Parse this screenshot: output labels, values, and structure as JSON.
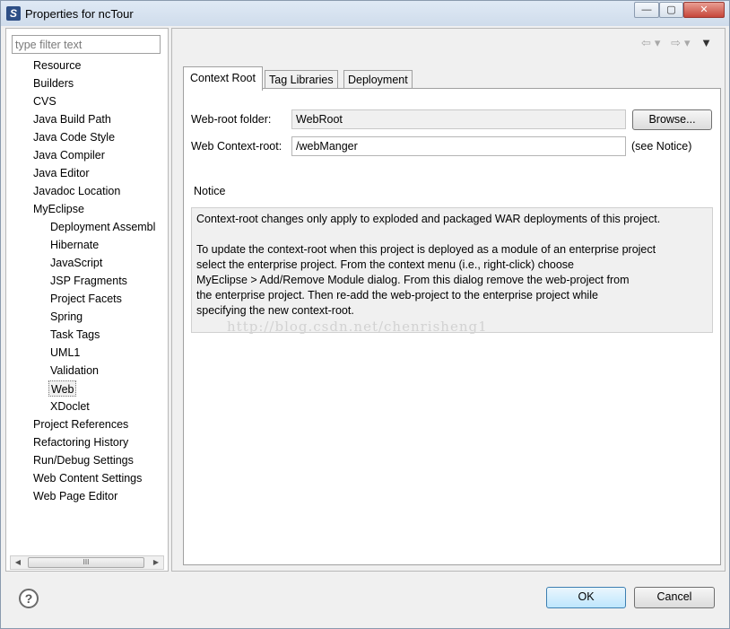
{
  "window": {
    "title": "Properties for ncTour",
    "controls": {
      "minimize": "—",
      "maximize": "▢",
      "close": "✕"
    }
  },
  "sidebar": {
    "filter_placeholder": "type filter text",
    "items": [
      {
        "label": "Resource",
        "level": 0
      },
      {
        "label": "Builders",
        "level": 0
      },
      {
        "label": "CVS",
        "level": 0
      },
      {
        "label": "Java Build Path",
        "level": 0
      },
      {
        "label": "Java Code Style",
        "level": 0
      },
      {
        "label": "Java Compiler",
        "level": 0
      },
      {
        "label": "Java Editor",
        "level": 0
      },
      {
        "label": "Javadoc Location",
        "level": 0
      },
      {
        "label": "MyEclipse",
        "level": 0
      },
      {
        "label": "Deployment Assembl",
        "level": 1
      },
      {
        "label": "Hibernate",
        "level": 1
      },
      {
        "label": "JavaScript",
        "level": 1
      },
      {
        "label": "JSP Fragments",
        "level": 1
      },
      {
        "label": "Project Facets",
        "level": 1
      },
      {
        "label": "Spring",
        "level": 1
      },
      {
        "label": "Task Tags",
        "level": 1
      },
      {
        "label": "UML1",
        "level": 1
      },
      {
        "label": "Validation",
        "level": 1
      },
      {
        "label": "Web",
        "level": 1,
        "selected": true
      },
      {
        "label": "XDoclet",
        "level": 1
      },
      {
        "label": "Project References",
        "level": 0
      },
      {
        "label": "Refactoring History",
        "level": 0
      },
      {
        "label": "Run/Debug Settings",
        "level": 0
      },
      {
        "label": "Web Content Settings",
        "level": 0
      },
      {
        "label": "Web Page Editor",
        "level": 0
      }
    ],
    "scroll_thumb_grip": "III"
  },
  "tabs": [
    {
      "label": "Context Root",
      "active": true
    },
    {
      "label": "Tag Libraries",
      "active": false
    },
    {
      "label": "Deployment",
      "active": false
    }
  ],
  "form": {
    "web_root_label": "Web-root folder:",
    "web_root_value": "WebRoot",
    "browse_label": "Browse...",
    "context_root_label": "Web Context-root:",
    "context_root_value": "/webManger",
    "see_notice": "(see Notice)"
  },
  "notice": {
    "heading": "Notice",
    "line1": "Context-root changes only apply to exploded and packaged WAR deployments of this project.",
    "line2": "To update the context-root when this project is deployed as a module of an enterprise project",
    "line3": "select the enterprise project. From the context menu (i.e., right-click) choose",
    "line4": "MyEclipse > Add/Remove Module dialog. From this dialog remove the web-project from",
    "line5": "the enterprise project. Then re-add the web-project to the enterprise project while",
    "line6": "specifying the new context-root.",
    "watermark": "http://blog.csdn.net/chenrisheng1"
  },
  "footer": {
    "help": "?",
    "ok": "OK",
    "cancel": "Cancel"
  },
  "colors": {
    "title_bar": "#d7e3f0",
    "ok_button": "#bee6fd",
    "close_button": "#c6463a"
  }
}
